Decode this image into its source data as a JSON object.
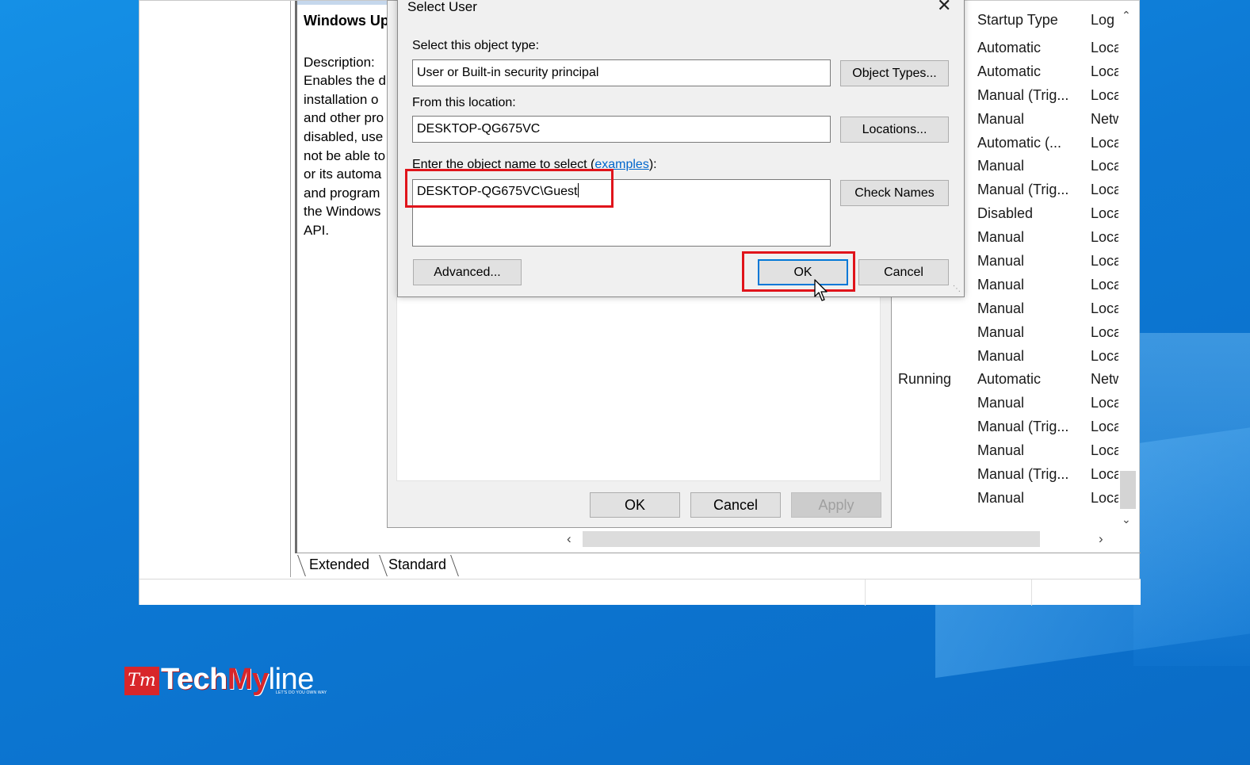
{
  "services_window": {
    "description_panel": {
      "title": "Windows Up",
      "lines": [
        "Description:",
        "Enables the d",
        "installation o",
        "and other pro",
        "disabled, use",
        "not be able to",
        "or its automa",
        "and program",
        "the Windows",
        "API."
      ]
    },
    "columns": {
      "startup_type": "Startup Type",
      "log_on_as": "Log"
    },
    "startup_types": [
      "Automatic",
      "Automatic",
      "Manual (Trig...",
      "Manual",
      "Automatic (...",
      "Manual",
      "Manual (Trig...",
      "Disabled",
      "Manual",
      "Manual",
      "Manual",
      "Manual",
      "Manual",
      "Manual",
      "Automatic",
      "Manual",
      "Manual (Trig...",
      "Manual",
      "Manual (Trig...",
      "Manual"
    ],
    "log_on_values": [
      "Loca",
      "Loca",
      "Loca",
      "Netw",
      "Loca",
      "Loca",
      "Loca",
      "Loca",
      "Loca",
      "Loca",
      "Loca",
      "Loca",
      "Loca",
      "Loca",
      "Netw",
      "Loca",
      "Loca",
      "Loca",
      "Loca",
      "Loca"
    ],
    "running_status": "Running",
    "tabs": {
      "extended": "Extended",
      "standard": "Standard"
    }
  },
  "properties_dialog": {
    "ok": "OK",
    "cancel": "Cancel",
    "apply": "Apply"
  },
  "select_user_dialog": {
    "title": "Select User",
    "object_type_label": "Select this object type:",
    "object_type_value": "User or Built-in security principal",
    "object_types_button": "Object Types...",
    "location_label": "From this location:",
    "location_value": "DESKTOP-QG675VC",
    "locations_button": "Locations...",
    "object_name_label_pre": "Enter the object name to select (",
    "examples_link": "examples",
    "object_name_label_post": "):",
    "object_name_value": "DESKTOP-QG675VC\\Guest",
    "check_names_button": "Check Names",
    "advanced_button": "Advanced...",
    "ok_button": "OK",
    "cancel_button": "Cancel"
  },
  "watermark": {
    "brand_mark": "Tm",
    "brand_part1": "Tech",
    "brand_part2": "My",
    "brand_part3": "line",
    "tagline": "LET'S DO YOU OWN WAY"
  },
  "colors": {
    "highlight": "#e0141b",
    "desktop": "#0d79d4",
    "link": "#0066cc",
    "brand_red": "#d8262a"
  }
}
